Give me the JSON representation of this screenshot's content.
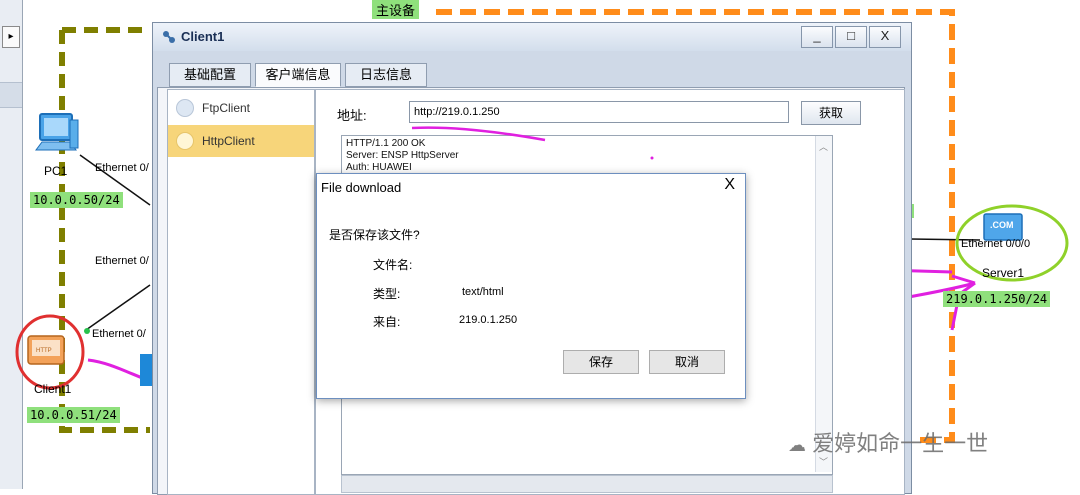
{
  "topology": {
    "top_label": "主设备",
    "pc1": {
      "name": "PC1",
      "ip": "10.0.0.50/24",
      "eth": "Ethernet 0/"
    },
    "client1": {
      "name": "Client1",
      "ip": "10.0.0.51/24",
      "eth": "Ethernet 0/",
      "icon_text": "HTTP"
    },
    "switch_eth": "Ethernet 0/",
    "server1": {
      "name": "Server1",
      "ip": "219.0.1.250/24",
      "eth": "Ethernet 0/0/0",
      "icon_text": ".COM"
    },
    "colors": {
      "ip_bg": "#8fe07c",
      "olive_dash": "#7f7f00",
      "orange_dash": "#ff8c1a",
      "magenta": "#e020e0",
      "red_circle": "#e03030",
      "green_circle": "#8fd12a"
    }
  },
  "window": {
    "title": "Client1",
    "controls": {
      "minimize": "_",
      "maximize": "□",
      "close": "X"
    },
    "tabs": [
      "基础配置",
      "客户端信息",
      "日志信息"
    ],
    "active_tab": 1,
    "sidebar": [
      {
        "label": "FtpClient",
        "selected": false
      },
      {
        "label": "HttpClient",
        "selected": true
      }
    ],
    "address_label": "地址:",
    "address_value": "http://219.0.1.250",
    "fetch_button": "获取",
    "response_lines": [
      "HTTP/1.1 200 OK",
      "Server: ENSP HttpServer",
      "Auth: HUAWEI"
    ]
  },
  "dialog": {
    "title": "File download",
    "close": "X",
    "question": "是否保存该文件?",
    "filename_label": "文件名:",
    "filename_value": "",
    "type_label": "类型:",
    "type_value": "text/html",
    "from_label": "来自:",
    "from_value": "219.0.1.250",
    "save_button": "保存",
    "cancel_button": "取消"
  },
  "watermark": "爱婷如命一生一世"
}
